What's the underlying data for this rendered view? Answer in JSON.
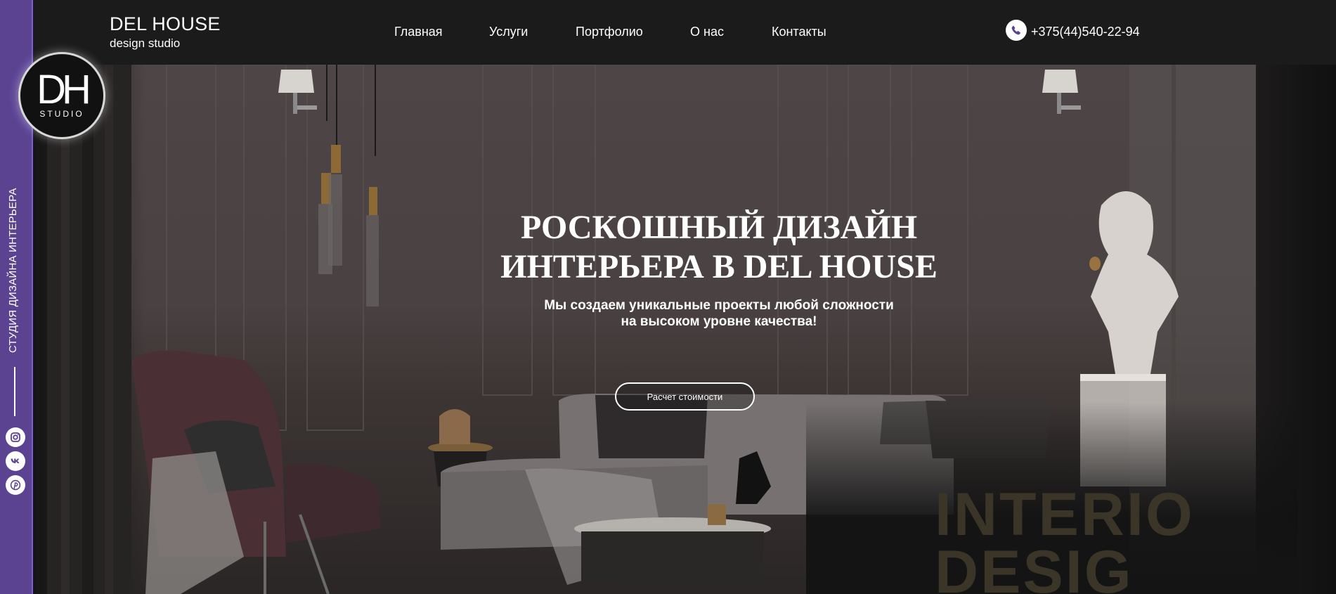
{
  "sidebar": {
    "tagline": "СТУДИЯ ДИЗАЙНА ИНТЕРЬЕРА",
    "social": [
      "instagram-icon",
      "vk-icon",
      "pinterest-icon"
    ]
  },
  "logo": {
    "letters": "DH",
    "sub": "STUDIO"
  },
  "header": {
    "brand_title": "DEL HOUSE",
    "brand_subtitle": "design studio",
    "nav": [
      "Главная",
      "Услуги",
      "Портфолио",
      "О нас",
      "Контакты"
    ],
    "phone": "+375(44)540-22-94"
  },
  "hero": {
    "title_line1": "РОСКОШНЫЙ ДИЗАЙН",
    "title_line2": "ИНТЕРЬЕРА В DEL HOUSE",
    "subtitle_line1": "Мы создаем уникальные проекты любой сложности",
    "subtitle_line2": "на высоком уровне качества!",
    "cta_label": "Расчет стоимости",
    "background_word_line1": "INTERIO",
    "background_word_line2": "DESIG"
  },
  "colors": {
    "sidebar": "#5b4392",
    "accent": "#7b5ed8",
    "header_bg": "#1b1b1b"
  }
}
